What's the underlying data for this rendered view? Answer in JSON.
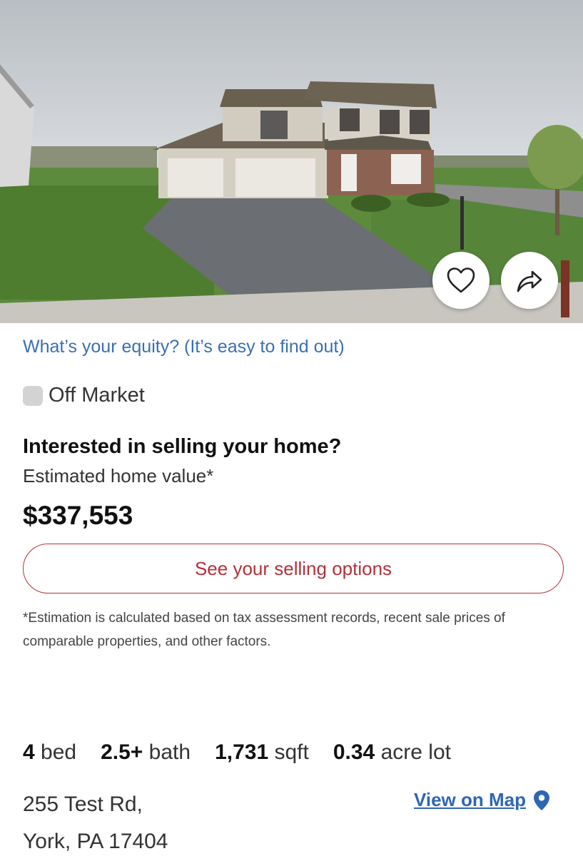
{
  "listing": {
    "equity_link": "What’s your equity? (It’s easy to find out)",
    "status": "Off Market",
    "sell_title": "Interested in selling your home?",
    "estimate_label": "Estimated home value*",
    "estimate_value": "$337,553",
    "sell_button": "See your selling options",
    "disclaimer": "*Estimation is calculated based on tax assessment records, recent sale prices of comparable properties, and other factors.",
    "facts": [
      {
        "value": "4",
        "unit": "bed"
      },
      {
        "value": "2.5+",
        "unit": "bath"
      },
      {
        "value": "1,731",
        "unit": "sqft"
      },
      {
        "value": "0.34",
        "unit": "acre lot"
      }
    ],
    "address_line1": "255 Test Rd,",
    "address_line2": "York, PA 17404",
    "map_link": "View on Map"
  },
  "icons": {
    "favorite": "heart-icon",
    "share": "share-arrow-icon",
    "map_pin": "map-pin-icon"
  },
  "colors": {
    "link_blue": "#3a6fb3",
    "accent_red": "#b3313a",
    "status_gray": "#d3d3d3"
  }
}
